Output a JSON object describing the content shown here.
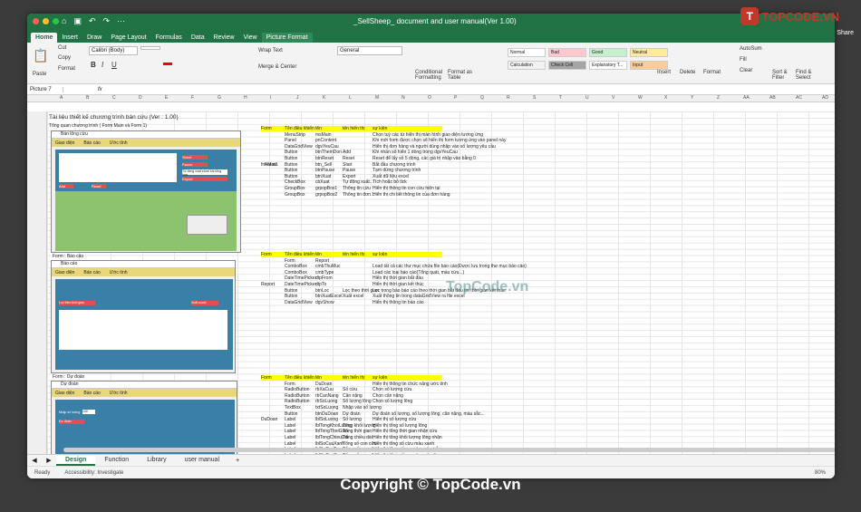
{
  "window": {
    "title": "_SellSheep_ document and user manual(Ver 1.00)"
  },
  "ribbon_tabs": [
    "Home",
    "Insert",
    "Draw",
    "Page Layout",
    "Formulas",
    "Data",
    "Review",
    "View",
    "Picture Format"
  ],
  "share_label": "Share",
  "ribbon": {
    "paste": "Paste",
    "cut": "Cut",
    "copy": "Copy",
    "format": "Format",
    "font": "Calibri (Body)",
    "wrap": "Wrap Text",
    "merge": "Merge & Center",
    "number_format": "General",
    "cond_format": "Conditional Formatting",
    "format_table": "Format as Table",
    "insert": "Insert",
    "delete": "Delete",
    "format_cells": "Format",
    "autosum": "AutoSum",
    "fill": "Fill",
    "clear": "Clear",
    "sort": "Sort & Filter",
    "find": "Find & Select",
    "styles": [
      "Normal",
      "Bad",
      "Good",
      "Neutral",
      "Calculation",
      "Check Cell",
      "Explanatory T...",
      "Input"
    ]
  },
  "formula_bar": {
    "name_box": "Picture 7",
    "fx": "fx"
  },
  "columns": [
    "A",
    "B",
    "C",
    "D",
    "E",
    "F",
    "G",
    "H",
    "I",
    "J",
    "K",
    "L",
    "M",
    "N",
    "O",
    "P",
    "Q",
    "R",
    "S",
    "T",
    "U",
    "V",
    "W",
    "X",
    "Y",
    "Z",
    "AA",
    "AB",
    "AC",
    "AD"
  ],
  "sheet": {
    "doc_title": "Tài liệu thiết kế chương trình bán cừu (Ver : 1.00)",
    "subtitle": "Tổng quan chương trình ( Form Main và Form 1)",
    "label_report": "Form : Báo cáo",
    "label_dudoan": "Form : Dự đoán",
    "table_header": {
      "form": "Form",
      "type": "Tên điều khiển",
      "name": "tên",
      "display": "tên hiển thị",
      "desc": "sự kiện"
    },
    "form_main": "frmMain",
    "form1": "Form1",
    "report": "Report",
    "dudoan": "DuDoan",
    "rows1": [
      [
        "MenuStrip",
        "msMain",
        "",
        "Chọn tuỳ các từ hiển thị màn hình giao diện tương ứng"
      ],
      [
        "Panel",
        "pnContent",
        "",
        "Khi mới form được chọn sẽ hiển thị form tương ứng vào panel này"
      ],
      [
        "DataGridView",
        "dgvYeuCau",
        "",
        "Hiển thị đơn hàng và người dùng nhập vào số lượng yêu cầu"
      ],
      [
        "Button",
        "btnThemDon",
        "Add",
        "Khi nhấn số hiển 1 dòng trong dgvYeuCau"
      ],
      [
        "Button",
        "btnReset",
        "Reset",
        "Reset để lấy số 5 dòng, các giá trị nhập vào bằng 0"
      ],
      [
        "Button",
        "btn_Sell",
        "Start",
        "Bắt đầu chương trình"
      ],
      [
        "Button",
        "btnPause",
        "Pause",
        "Tạm dừng chương trình"
      ],
      [
        "Button",
        "btnXuat",
        "Export",
        "Xuất dữ liệu excel"
      ],
      [
        "CheckBox",
        "cbXuat",
        "Tự động xuất...",
        "Tích hoặc bỏ tick"
      ],
      [
        "GroupBox",
        "grpopBox1",
        "Thông tin cừu",
        "Hiển thị thông tin con cừu hiện tại"
      ],
      [
        "GroupBox",
        "grpopBox2",
        "Thông tin đơn...",
        "Hiển thị chi tiết thông tin của đơn hàng"
      ]
    ],
    "rows2": [
      [
        "Form",
        "Report",
        "",
        ""
      ],
      [
        "ComboBox",
        "cmbThuMuc",
        "",
        "Load tất cả các thư mục chứa file báo cáo(Được lưu trong thư mục báo cáo)"
      ],
      [
        "ComboBox",
        "cmbType",
        "",
        "Load các loại báo cáo(Tổng quát, màu cừu...)"
      ],
      [
        "DateTimePicker",
        "dtpFrom",
        "",
        "Hiển thị thời gian bắt đầu"
      ],
      [
        "DateTimePicker",
        "dtpTo",
        "",
        "Hiển thị thời gian kết thúc"
      ],
      [
        "Button",
        "btnLoc",
        "Lọc theo thời gian",
        "Lọc trong bảo báo cáo theo thời gian bắt đầu tới thời gian kết thúc"
      ],
      [
        "Button",
        "btnXuatExcel",
        "Xuất excel",
        "Xuất thông tin trong dataGridView ra file excel"
      ],
      [
        "DataGridView",
        "dgvShow",
        "",
        "Hiển thị thông tin báo cáo"
      ]
    ],
    "rows3": [
      [
        "Form",
        "DuDoan",
        "",
        "Hiển thị thông tin chức năng ước tính"
      ],
      [
        "RadioButton",
        "rbXaCuu",
        "Số cừu",
        "Chọn số lượng cừu"
      ],
      [
        "RadioButton",
        "rbCanNang",
        "Cân nặng",
        "Chọn cân nặng"
      ],
      [
        "RadioButton",
        "rbSoLuong",
        "Số lượng lông",
        "Chọn số lượng lông"
      ],
      [
        "TextBox",
        "txtSoLuong",
        "Nhập vào số lượng",
        ""
      ],
      [
        "Button",
        "btnDuDoan",
        "Dự đoán",
        "Dự đoán số lượng, số lượng lông, cân nặng, màu sắc..."
      ],
      [
        "Label",
        "lblSoLuong",
        "Số lượng",
        "Hiển thị số lượng cừu"
      ],
      [
        "Label",
        "lblTongKhoiLuong",
        "Tổng khối lượng",
        "Hiển thị tổng số lượng lông"
      ],
      [
        "Label",
        "lblTongThoiGian",
        "Tổng thời gian",
        "Hiển thị tổng thời gian nhận cừu"
      ],
      [
        "Label",
        "lblTongChieuDai",
        "Tổng chiều dài",
        "Hiển thị tổng khối lượng lông nhận"
      ],
      [
        "Label",
        "lblSoCuuXanh",
        "Tổng số con cừu",
        "Hiển thị tổng số cừu màu xanh"
      ],
      [
        "Label",
        "lblSoCuuTrang",
        "Tổng số con cừu",
        "Hiển thị tổng số con cừu màu trắng"
      ],
      [
        "Label",
        "lblSoCuuDen",
        "Tổng số con cừu",
        "Hiển thị tổng số con cừu màu đen"
      ]
    ],
    "shot1_menu": [
      "Giao diện",
      "Báo cáo",
      "Ước tính"
    ],
    "shot1_title": "Bán lông cừu",
    "shot1_buttons": [
      "Add",
      "Reset",
      "Sheet",
      "Pause",
      "Export"
    ],
    "shot1_checkbox": "Tự động xuất excel khi tổng hợp",
    "shot2_title": "Báo cáo",
    "shot2_btn": "Lọc theo thời gian",
    "shot2_export": "Xuất excel",
    "shot3_title": "Dự đoán",
    "shot3_btn": "Dự đoán",
    "shot3_input_label": "Nhập số lượng",
    "shot3_input_value": "100"
  },
  "sheet_tabs": [
    "Design",
    "Function",
    "Library",
    "user manual"
  ],
  "status": {
    "ready": "Ready",
    "accessibility": "Accessibility: Investigate",
    "zoom": "80%"
  },
  "logo_text": "TOPCODE.VN",
  "logo_badge": "T",
  "watermark": "TopCode.vn",
  "copyright": "Copyright © TopCode.vn"
}
